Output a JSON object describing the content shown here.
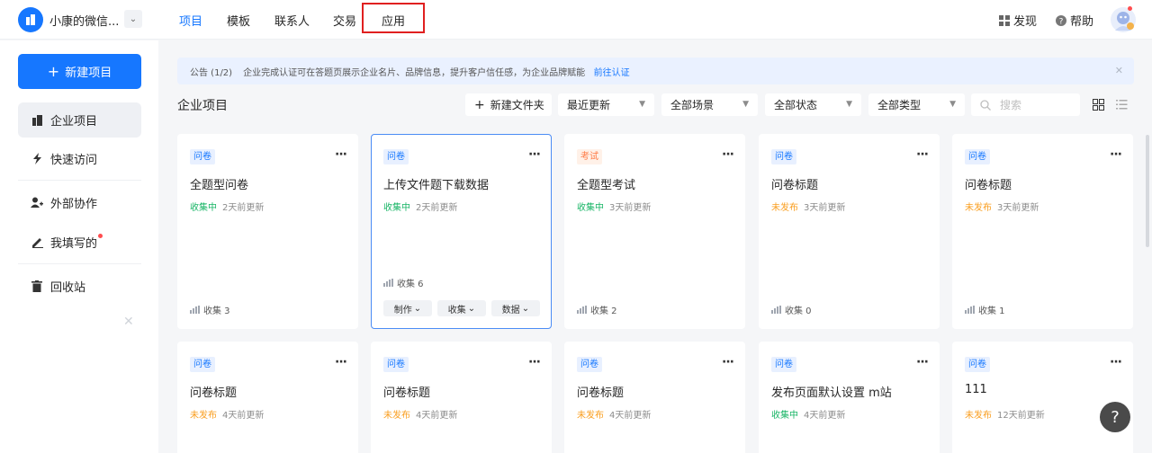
{
  "topbar": {
    "workspace_name": "小康的微信...",
    "nav": [
      {
        "label": "项目",
        "active": true
      },
      {
        "label": "模板",
        "active": false
      },
      {
        "label": "联系人",
        "active": false
      },
      {
        "label": "交易",
        "active": false
      },
      {
        "label": "应用",
        "active": false
      }
    ],
    "discover_label": "发现",
    "help_label": "帮助"
  },
  "sidebar": {
    "new_project_label": "新建项目",
    "items": [
      {
        "label": "企业项目",
        "icon": "building-icon",
        "active": true
      },
      {
        "label": "快速访问",
        "icon": "lightning-icon",
        "active": false
      },
      {
        "label": "外部协作",
        "icon": "user-add-icon",
        "active": false
      },
      {
        "label": "我填写的",
        "icon": "pen-icon",
        "active": false,
        "dot": true
      },
      {
        "label": "回收站",
        "icon": "trash-icon",
        "active": false
      }
    ]
  },
  "notice": {
    "label": "公告 (1/2)",
    "text": "企业完成认证可在答题页展示企业名片、品牌信息，提升客户信任感，为企业品牌赋能",
    "link": "前往认证"
  },
  "toolbar": {
    "title": "企业项目",
    "new_folder": "新建文件夹",
    "filters": [
      "最近更新",
      "全部场景",
      "全部状态",
      "全部类型"
    ],
    "search_placeholder": "搜索"
  },
  "cards": [
    {
      "badge": "问卷",
      "badge_color": "blue",
      "title": "全题型问卷",
      "status": "收集中",
      "status_color": "green",
      "time": "2天前更新",
      "collect": "收集 3"
    },
    {
      "badge": "问卷",
      "badge_color": "blue",
      "title": "上传文件题下载数据",
      "status": "收集中",
      "status_color": "green",
      "time": "2天前更新",
      "collect": "收集 6",
      "selected": true,
      "actions": [
        "制作",
        "收集",
        "数据"
      ]
    },
    {
      "badge": "考试",
      "badge_color": "orange",
      "title": "全题型考试",
      "status": "收集中",
      "status_color": "green",
      "time": "3天前更新",
      "collect": "收集 2"
    },
    {
      "badge": "问卷",
      "badge_color": "blue",
      "title": "问卷标题",
      "status": "未发布",
      "status_color": "orange",
      "time": "3天前更新",
      "collect": "收集 0"
    },
    {
      "badge": "问卷",
      "badge_color": "blue",
      "title": "问卷标题",
      "status": "未发布",
      "status_color": "orange",
      "time": "3天前更新",
      "collect": "收集 1"
    },
    {
      "badge": "问卷",
      "badge_color": "blue",
      "title": "问卷标题",
      "status": "未发布",
      "status_color": "orange",
      "time": "4天前更新"
    },
    {
      "badge": "问卷",
      "badge_color": "blue",
      "title": "问卷标题",
      "status": "未发布",
      "status_color": "orange",
      "time": "4天前更新"
    },
    {
      "badge": "问卷",
      "badge_color": "blue",
      "title": "问卷标题",
      "status": "未发布",
      "status_color": "orange",
      "time": "4天前更新"
    },
    {
      "badge": "问卷",
      "badge_color": "blue",
      "title": "发布页面默认设置 m站",
      "status": "收集中",
      "status_color": "green",
      "time": "4天前更新"
    },
    {
      "badge": "问卷",
      "badge_color": "blue",
      "title": "111",
      "status": "未发布",
      "status_color": "orange",
      "time": "12天前更新"
    }
  ],
  "help_fab": "?",
  "colors": {
    "accent": "#1677ff",
    "green": "#18b566",
    "orange": "#fa9e1f",
    "highlight_box": "#e02020"
  }
}
